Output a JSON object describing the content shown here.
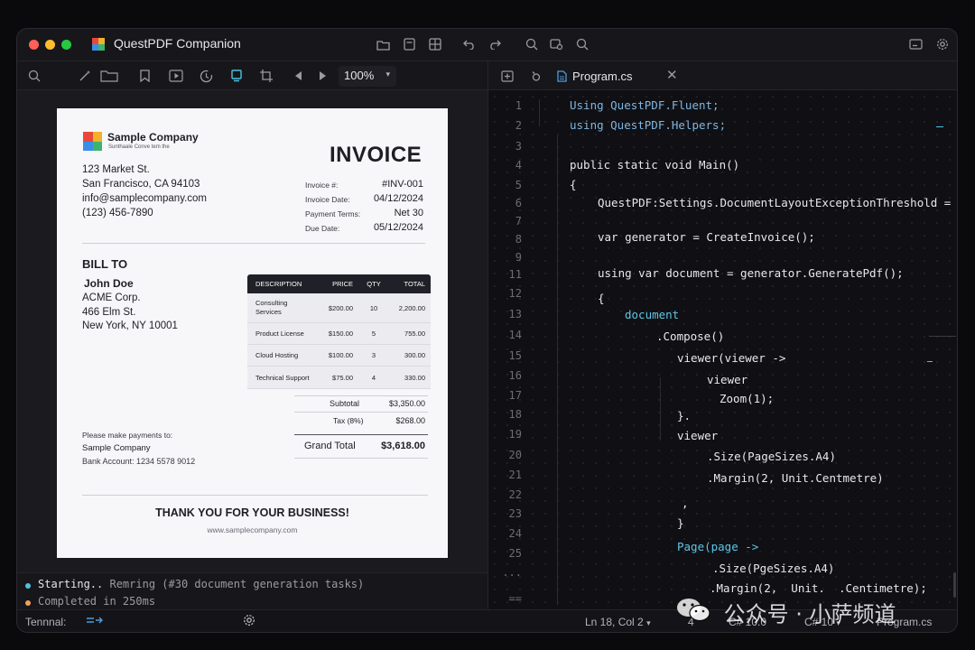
{
  "window": {
    "title": "QuestPDF Companion"
  },
  "toolbar": {
    "zoom": "100%"
  },
  "editor": {
    "tab_label": "Program.cs",
    "line_numbers": [
      "1",
      "2",
      "3",
      "4",
      "5",
      "6",
      "7",
      "8",
      "9",
      "11",
      "12",
      "13",
      "14",
      "15",
      "16",
      "17",
      "18",
      "19",
      "20",
      "21",
      "22",
      "23",
      "24",
      "25",
      "...",
      "=="
    ],
    "lines": [
      {
        "text": "Using QuestPDF.Fluent;"
      },
      {
        "text": "using QuestPDF.Helpers;"
      },
      {
        "text": "public static void Main()"
      },
      {
        "text": "{"
      },
      {
        "text": "QuestPDF:Settings.DocumentLayoutExceptionThreshold ="
      },
      {
        "text": "var generator = CreateInvoice();"
      },
      {
        "text": "using var document = generator.GeneratePdf();"
      },
      {
        "text": "{"
      },
      {
        "text": "document"
      },
      {
        "text": ".Compose()"
      },
      {
        "text": "viewer(viewer ->"
      },
      {
        "text": "viewer"
      },
      {
        "text": "Zoom(1);"
      },
      {
        "text": "}."
      },
      {
        "text": "viewer"
      },
      {
        "text": ".Size(PageSizes.A4)"
      },
      {
        "text": ".Margin(2, Unit.Centmetre)"
      },
      {
        "text": ","
      },
      {
        "text": "}"
      },
      {
        "text": "Page(page ->"
      },
      {
        "text": ".Size(PgeSizes.A4)"
      },
      {
        "text": ".Margin(2,  Unit.  .Centimetre);"
      }
    ]
  },
  "invoice": {
    "company_name": "Sample Company",
    "company_tagline": "Sunthaale Conve tem the",
    "title": "INVOICE",
    "address": [
      "123 Market St.",
      "San Francisco, CA 94103",
      "info@samplecompany.com",
      "(123) 456-7890"
    ],
    "meta": [
      {
        "label": "Invoice #:",
        "value": "#INV-001"
      },
      {
        "label": "Invoice Date:",
        "value": "04/12/2024"
      },
      {
        "label": "Payment Terms:",
        "value": "Net 30"
      },
      {
        "label": "Due Date:",
        "value": "05/12/2024"
      }
    ],
    "bill_to_heading": "BILL TO",
    "bill_to": [
      "John Doe",
      "ACME Corp.",
      "466 Elm St.",
      "New York, NY 10001"
    ],
    "table_headers": [
      "DESCRIPTION",
      "PRICE",
      "QTY",
      "TOTAL"
    ],
    "table_rows": [
      [
        "Consulting Services",
        "$200.00",
        "10",
        "2,200.00"
      ],
      [
        "Product License",
        "$150.00",
        "5",
        "755.00"
      ],
      [
        "Cloud Hosting",
        "$100.00",
        "3",
        "300.00"
      ],
      [
        "Technical Support",
        "$75.00",
        "4",
        "330.00"
      ]
    ],
    "subtotal_label": "Subtotal",
    "subtotal": "$3,350.00",
    "tax_label": "Tax (8%)",
    "tax": "$268.00",
    "grand_total_label": "Grand Total",
    "grand_total": "$3,618.00",
    "payment_note": "Please make payments to:",
    "payment_company": "Sample Company",
    "bank_account": "Bank Account: 1234 5578 9012",
    "thanks": "THANK YOU FOR YOUR BUSINESS!",
    "website": "www.samplecompany.com"
  },
  "terminal": {
    "line1_prefix": "Starting..",
    "line1_rest": "Remring (#30 document generation tasks)",
    "line2": "Completed in 250ms"
  },
  "statusbar": {
    "terminal_label": "Tennnal:",
    "position": "Ln 18, Col 2",
    "indent": "4",
    "language_label": "C# 10.0",
    "language": "C# 10",
    "file": "Program.cs"
  },
  "watermark": "公众号 · 小萨频道",
  "colors": {
    "accent": "#4cc3e0",
    "background": "#17171b",
    "editor_bg": "#101014",
    "paper": "#f7f6f9"
  }
}
